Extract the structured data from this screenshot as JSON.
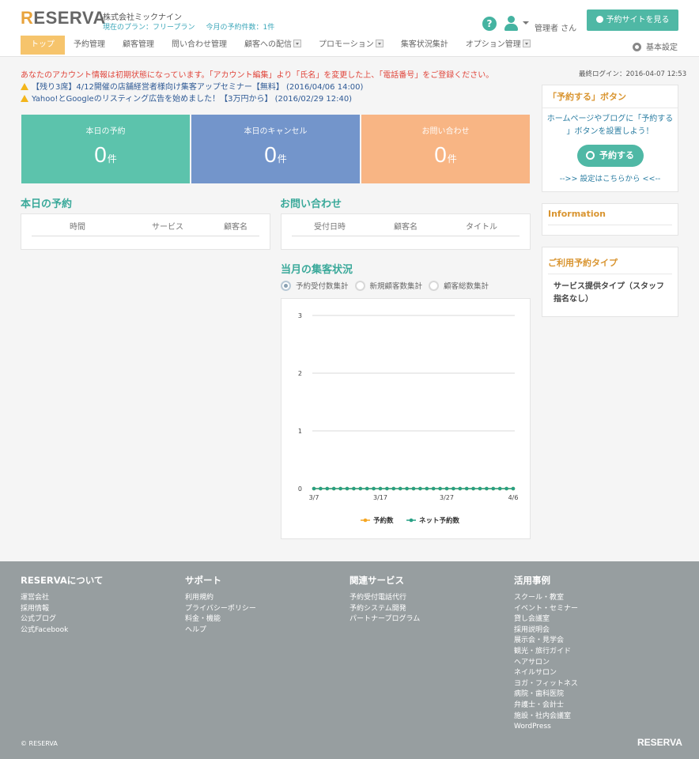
{
  "header": {
    "logo_r": "R",
    "logo_rest": "ESERVA",
    "company": "株式会社ミックナイン",
    "plan": "現在のプラン：フリープラン",
    "today_count": "今月の予約件数：1件",
    "admin_label": "管理者 さん",
    "site_button": "予約サイトを見る"
  },
  "nav": {
    "items": [
      {
        "label": "トップ"
      },
      {
        "label": "予約管理"
      },
      {
        "label": "顧客管理"
      },
      {
        "label": "問い合わせ管理"
      },
      {
        "label": "顧客への配信"
      },
      {
        "label": "プロモーション"
      },
      {
        "label": "集客状況集計"
      },
      {
        "label": "オプション管理"
      }
    ],
    "settings": "基本設定"
  },
  "notices": {
    "account_warning": "あなたのアカウント情報は初期状態になっています。「アカウント編集」より「氏名」を変更した上、「電話番号」をご登録ください。",
    "last_login": "最終ログイン：2016-04-07 12:53",
    "news": [
      "【残り3席】4/12開催の店舗経営者様向け集客アップセミナー【無料】 (2016/04/06 14:00)",
      "Yahoo!とGoogleのリスティング広告を始めました！【3万円から】 (2016/02/29 12:40)"
    ]
  },
  "stats": [
    {
      "label": "本日の予約",
      "value": "0",
      "unit": "件",
      "color": "#5cc3ac"
    },
    {
      "label": "本日のキャンセル",
      "value": "0",
      "unit": "件",
      "color": "#7395cb"
    },
    {
      "label": "お問い合わせ",
      "value": "0",
      "unit": "件",
      "color": "#f8b584"
    }
  ],
  "today_reservations": {
    "title": "本日の予約",
    "columns": [
      "時間",
      "サービス",
      "顧客名"
    ]
  },
  "inquiries": {
    "title": "お問い合わせ",
    "columns": [
      "受付日時",
      "顧客名",
      "タイトル"
    ]
  },
  "monthly": {
    "title": "当月の集客状況",
    "radios": [
      "予約受付数集計",
      "新規顧客数集計",
      "顧客総数集計"
    ]
  },
  "chart_data": {
    "type": "line",
    "x": [
      "3/7",
      "3/8",
      "3/9",
      "3/10",
      "3/11",
      "3/12",
      "3/13",
      "3/14",
      "3/15",
      "3/16",
      "3/17",
      "3/18",
      "3/19",
      "3/20",
      "3/21",
      "3/22",
      "3/23",
      "3/24",
      "3/25",
      "3/26",
      "3/27",
      "3/28",
      "3/29",
      "3/30",
      "3/31",
      "4/1",
      "4/2",
      "4/3",
      "4/4",
      "4/5",
      "4/6"
    ],
    "xticks": [
      "3/7",
      "3/17",
      "3/27",
      "4/6"
    ],
    "yticks": [
      "0",
      "1",
      "2",
      "3"
    ],
    "ylim": [
      0,
      3
    ],
    "series": [
      {
        "name": "予約数",
        "color": "#f5a623",
        "values": [
          0,
          0,
          0,
          0,
          0,
          0,
          0,
          0,
          0,
          0,
          0,
          0,
          0,
          0,
          0,
          0,
          0,
          0,
          0,
          0,
          0,
          0,
          0,
          0,
          0,
          0,
          0,
          0,
          0,
          0,
          0
        ]
      },
      {
        "name": "ネット予約数",
        "color": "#27a085",
        "values": [
          0,
          0,
          0,
          0,
          0,
          0,
          0,
          0,
          0,
          0,
          0,
          0,
          0,
          0,
          0,
          0,
          0,
          0,
          0,
          0,
          0,
          0,
          0,
          0,
          0,
          0,
          0,
          0,
          0,
          0,
          0
        ]
      }
    ],
    "grid": true,
    "legend": "bottom"
  },
  "sidebar": {
    "reserve_box": {
      "title": "「予約する」ボタン",
      "text_line1": "ホームページやブログに「予約する",
      "text_line2": "」ボタンを設置しよう！",
      "button": "予約する",
      "link": "-->> 設定はこちらから <<--"
    },
    "info_title": "Information",
    "type_box": {
      "title": "ご利用予約タイプ",
      "line1": "サービス提供タイプ（スタッフ",
      "line2": "指名なし）"
    }
  },
  "footer": {
    "columns": [
      {
        "title": "RESERVAについて",
        "links": [
          "運営会社",
          "採用情報",
          "公式ブログ",
          "公式Facebook"
        ]
      },
      {
        "title": "サポート",
        "links": [
          "利用規約",
          "プライバシーポリシー",
          "料金・機能",
          "ヘルプ"
        ]
      },
      {
        "title": "関連サービス",
        "links": [
          "予約受付電話代行",
          "予約システム開発",
          "パートナープログラム"
        ]
      },
      {
        "title": "活用事例",
        "links": [
          "スクール・教室",
          "イベント・セミナー",
          "貸し会議室",
          "採用説明会",
          "展示会・見学会",
          "観光・旅行ガイド",
          "ヘアサロン",
          "ネイルサロン",
          "ヨガ・フィットネス",
          "病院・歯科医院",
          "弁護士・会計士",
          "施設・社内会議室",
          "WordPress"
        ]
      }
    ],
    "copyright": "© RESERVA",
    "logo": "RESERVA"
  }
}
